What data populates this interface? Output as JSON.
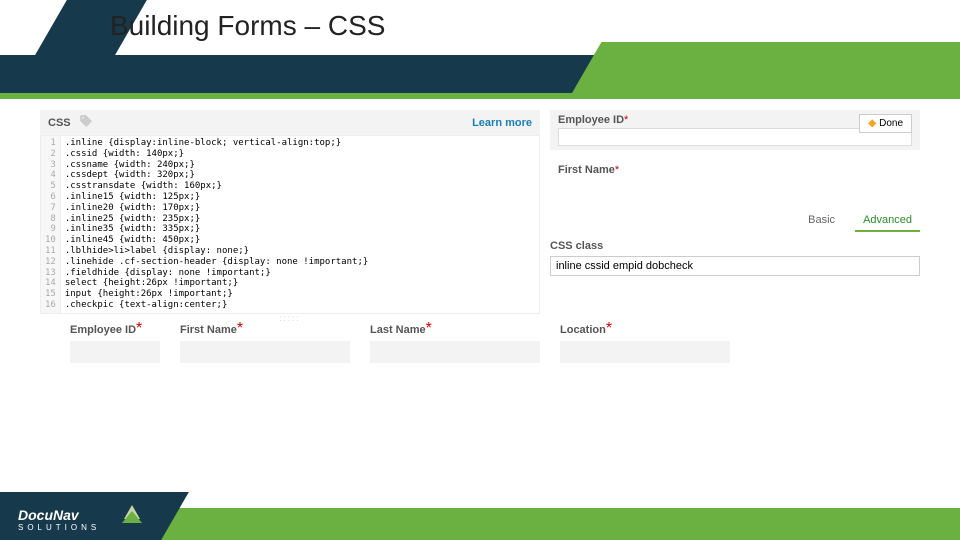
{
  "header": {
    "title": "Building Forms – CSS"
  },
  "cssPanel": {
    "label": "CSS",
    "learnMore": "Learn more",
    "lines": [
      ".inline {display:inline-block; vertical-align:top;}",
      ".cssid {width: 140px;}",
      ".cssname {width: 240px;}",
      ".cssdept {width: 320px;}",
      ".csstransdate {width: 160px;}",
      ".inline15 {width: 125px;}",
      ".inline20 {width: 170px;}",
      ".inline25 {width: 235px;}",
      ".inline35 {width: 335px;}",
      ".inline45 {width: 450px;}",
      ".lblhide>li>label {display: none;}",
      ".linehide .cf-section-header {display: none !important;}",
      ".fieldhide {display: none !important;}",
      "select {height:26px !important;}",
      "input {height:26px !important;}",
      ".checkpic {text-align:center;}"
    ]
  },
  "rightPanel": {
    "field1": "Employee ID",
    "field2": "First Name",
    "done": "Done",
    "tabs": {
      "basic": "Basic",
      "advanced": "Advanced"
    },
    "cssClassLabel": "CSS class",
    "cssClassValue": "inline cssid empid dobcheck"
  },
  "preview": {
    "f1": "Employee ID",
    "f2": "First Name",
    "f3": "Last Name",
    "f4": "Location"
  },
  "footer": {
    "logoTop": "DocuNav",
    "logoBottom": "SOLUTIONS"
  },
  "asterisk": "*"
}
